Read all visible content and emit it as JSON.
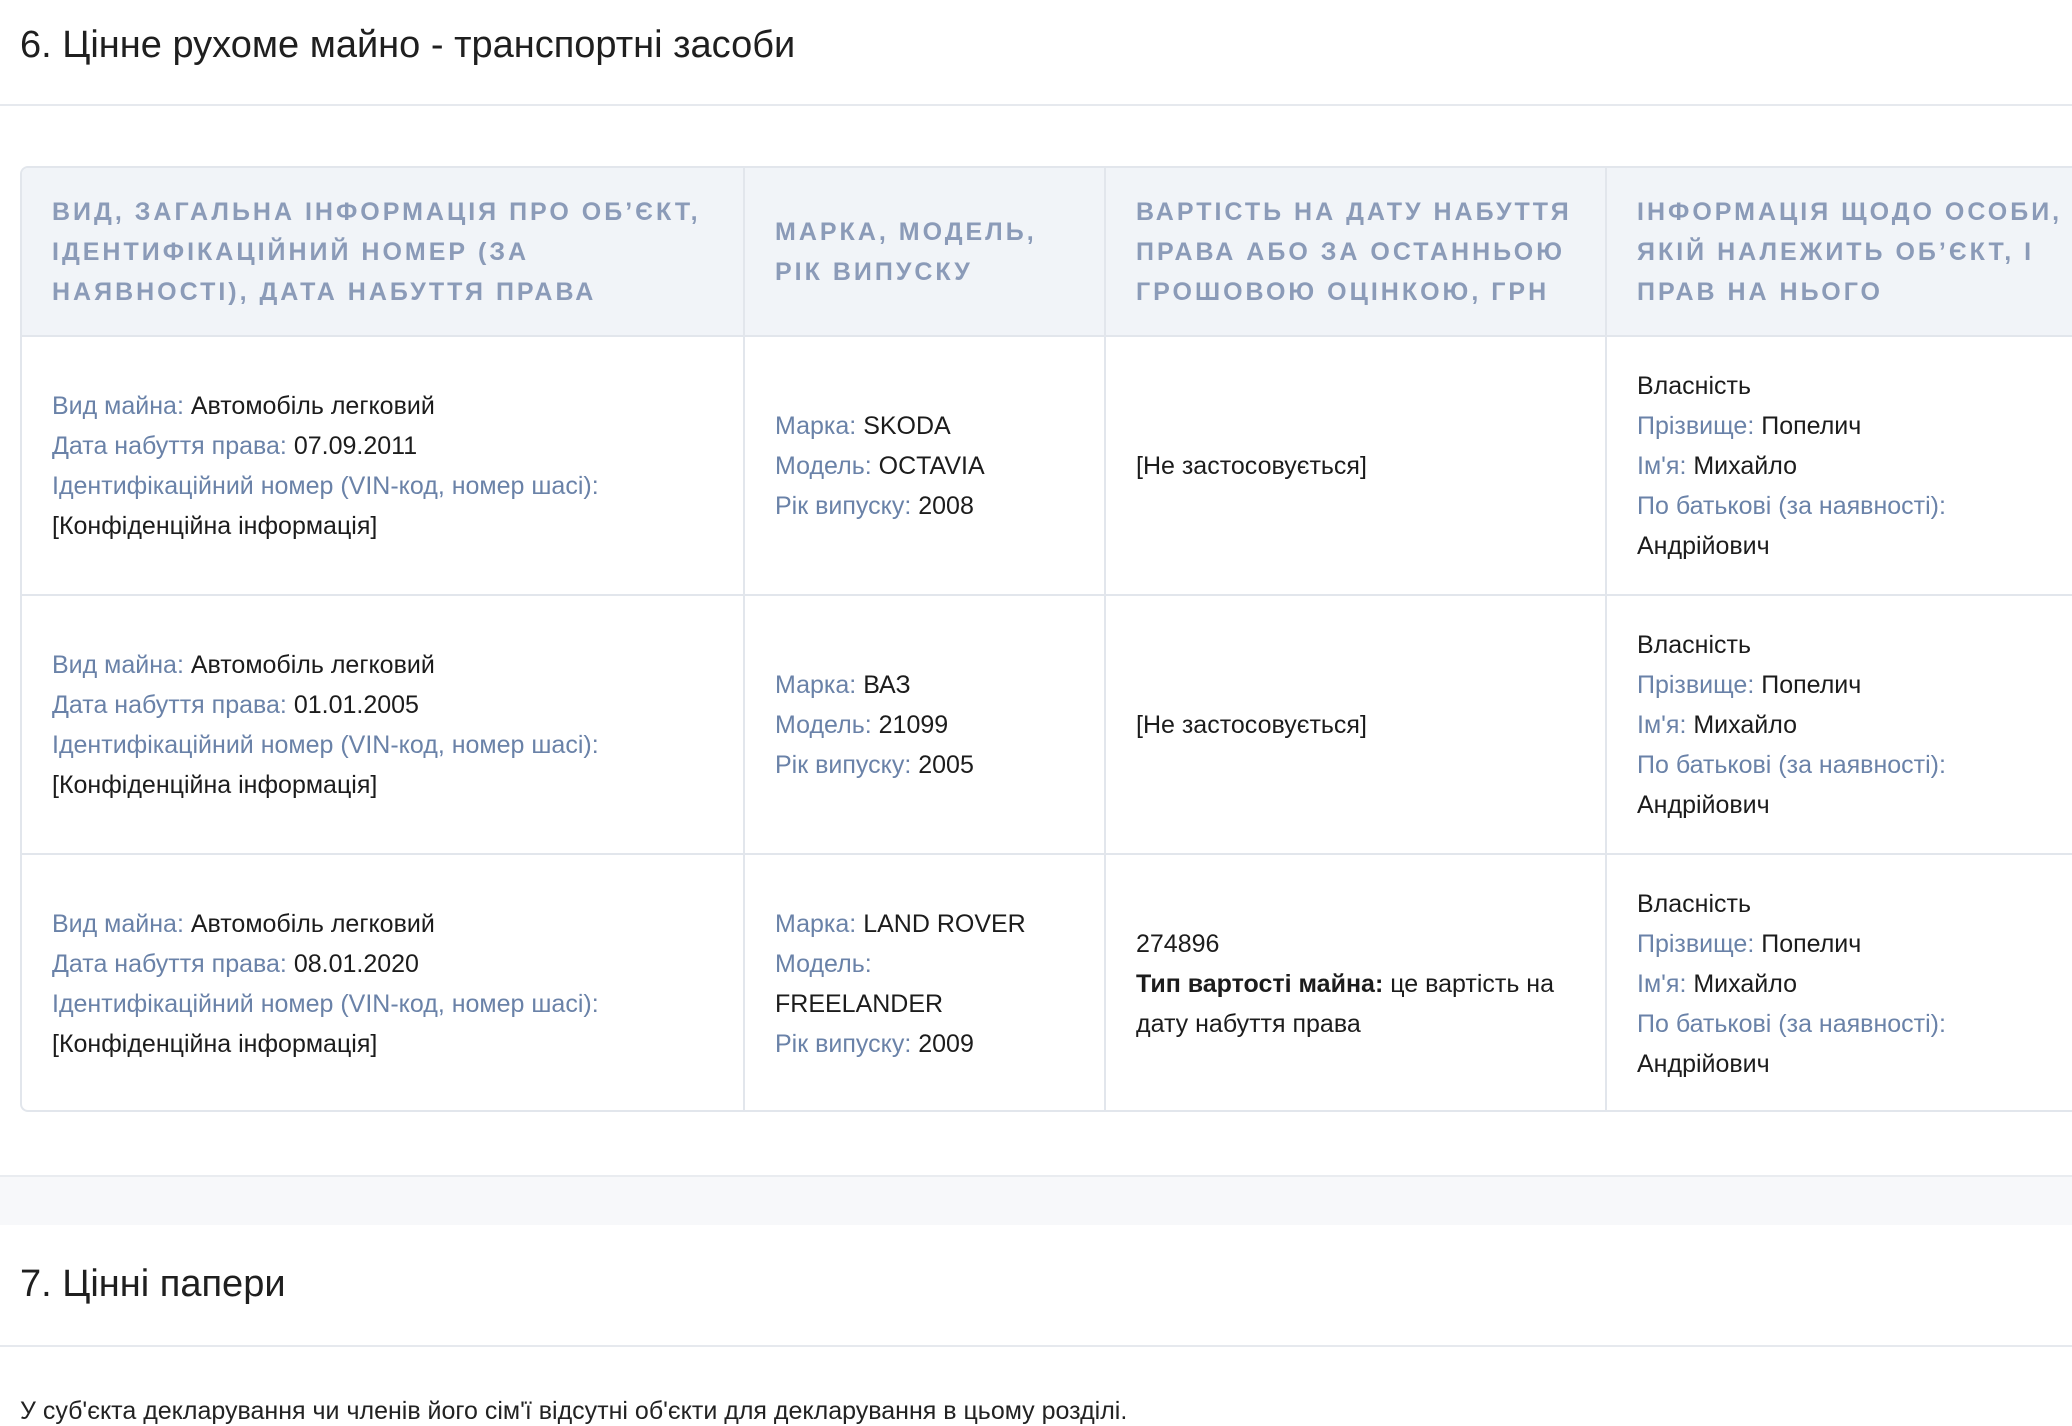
{
  "section6": {
    "title": "6. Цінне рухоме майно - транспортні засоби",
    "columns": [
      "Вид, загальна інформація про об’єкт, ідентифікаційний номер (за наявності), дата набуття права",
      "Марка, модель, рік випуску",
      "Вартість на дату набуття права або за останньою грошовою оцінкою, грн",
      "Інформація щодо особи, якій належить об’єкт, і прав на нього"
    ],
    "labels": {
      "type": "Вид майна:",
      "date": "Дата набуття права:",
      "vin": "Ідентифікаційний номер (VIN-код, номер шасі):",
      "brand": "Марка:",
      "model": "Модель:",
      "year": "Рік випуску:",
      "value_type": "Тип вартості майна:",
      "surname": "Прізвище:",
      "name": "Ім'я:",
      "patronymic": "По батькові (за наявності):"
    },
    "rows": [
      {
        "type": "Автомобіль легковий",
        "date": "07.09.2011",
        "vin": "[Конфіденційна інформація]",
        "brand": "SKODA",
        "model": "OCTAVIA",
        "year": "2008",
        "value": "[Не застосовується]",
        "right": "Власність",
        "surname": "Попелич",
        "name": "Михайло",
        "patronymic": "Андрійович"
      },
      {
        "type": "Автомобіль легковий",
        "date": "01.01.2005",
        "vin": "[Конфіденційна інформація]",
        "brand": "ВАЗ",
        "model": "21099",
        "year": "2005",
        "value": "[Не застосовується]",
        "right": "Власність",
        "surname": "Попелич",
        "name": "Михайло",
        "patronymic": "Андрійович"
      },
      {
        "type": "Автомобіль легковий",
        "date": "08.01.2020",
        "vin": "[Конфіденційна інформація]",
        "brand": "LAND ROVER",
        "model": "FREELANDER",
        "year": "2009",
        "value": "274896",
        "value_type": "це вартість на дату набуття права",
        "right": "Власність",
        "surname": "Попелич",
        "name": "Михайло",
        "patronymic": "Андрійович"
      }
    ]
  },
  "section7": {
    "title": "7. Цінні папери",
    "empty_note": "У суб'єкта декларування чи членів його сім'ї відсутні об'єкти для декларування в цьому розділі."
  }
}
